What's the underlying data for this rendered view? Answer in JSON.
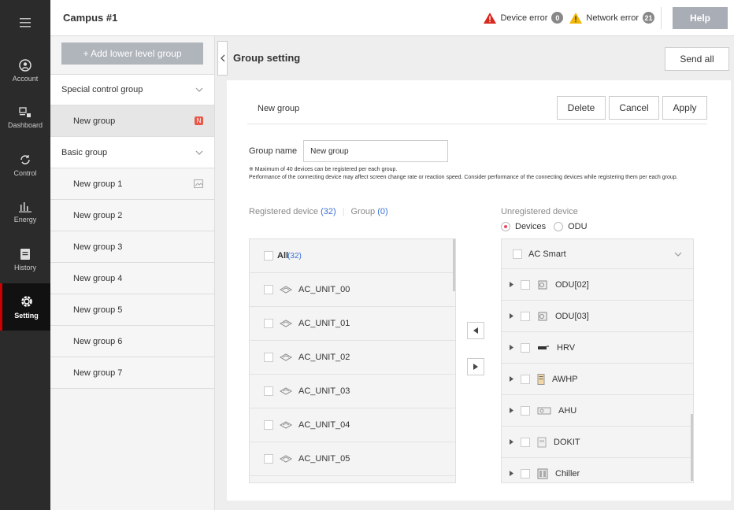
{
  "nav": {
    "items": [
      {
        "label": "Account",
        "icon": "account-icon"
      },
      {
        "label": "Dashboard",
        "icon": "dashboard-icon"
      },
      {
        "label": "Control",
        "icon": "control-icon"
      },
      {
        "label": "Energy",
        "icon": "energy-icon"
      },
      {
        "label": "History",
        "icon": "history-icon"
      },
      {
        "label": "Setting",
        "icon": "gear-icon",
        "active": true
      }
    ]
  },
  "topbar": {
    "title": "Campus #1",
    "device_error_label": "Device error",
    "device_error_count": "0",
    "network_error_label": "Network error",
    "network_error_count": "21",
    "help_label": "Help"
  },
  "sidebar": {
    "add_label": "+ Add lower level group",
    "special_group": "Special control group",
    "special_children": [
      {
        "label": "New group",
        "badge": "N"
      }
    ],
    "basic_group": "Basic group",
    "basic_children": [
      "New group 1",
      "New group 2",
      "New group 3",
      "New group 4",
      "New group 5",
      "New group 6",
      "New group 7"
    ]
  },
  "main": {
    "title": "Group setting",
    "send_all": "Send all",
    "panel_name": "New group",
    "delete": "Delete",
    "cancel": "Cancel",
    "apply": "Apply",
    "group_name_label": "Group name",
    "group_name_value": "New group",
    "note1": "※ Maximum of 40 devices can be registered per each group.",
    "note2": "Performance of the connecting device may affect screen change rate or reaction speed. Consider performance of the connecting devices while registering them per each group.",
    "registered_label": "Registered device",
    "registered_count": "(32)",
    "group_label": "Group",
    "group_count": "(0)",
    "unregistered_label": "Unregistered device",
    "radio_devices": "Devices",
    "radio_odu": "ODU",
    "all_label": "All",
    "all_count": "(32)",
    "registered_devices": [
      "AC_UNIT_00",
      "AC_UNIT_01",
      "AC_UNIT_02",
      "AC_UNIT_03",
      "AC_UNIT_04",
      "AC_UNIT_05"
    ],
    "unreg_header": "AC Smart",
    "unregistered_devices": [
      "ODU[02]",
      "ODU[03]",
      "HRV",
      "AWHP",
      "AHU",
      "DOKIT",
      "Chiller"
    ]
  },
  "colors": {
    "accent": "#e84a5f",
    "link": "#3a6fd8",
    "nav_bg": "#2b2b2b"
  }
}
